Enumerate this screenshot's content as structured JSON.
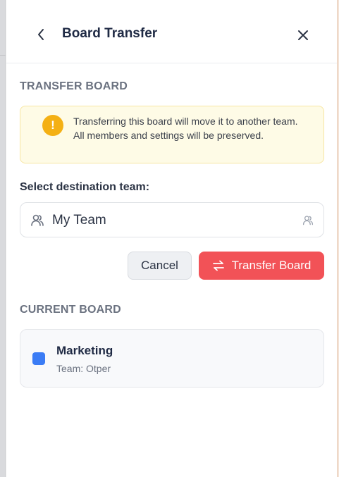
{
  "header": {
    "title": "Board Transfer",
    "back_icon": "chevron-left-icon",
    "close_icon": "close-icon"
  },
  "transfer_section": {
    "title": "TRANSFER BOARD",
    "warning": {
      "icon": "exclamation-icon",
      "icon_glyph": "!",
      "text": "Transferring this board will move it to another team. All members and settings will be preserved.",
      "color": "#f4b014"
    },
    "field_label": "Select destination team:",
    "select": {
      "value": "My Team",
      "lead_icon": "users-icon",
      "trail_icon": "users-icon"
    },
    "buttons": {
      "cancel_label": "Cancel",
      "transfer_label": "Transfer Board",
      "transfer_icon": "swap-arrows-icon",
      "transfer_color": "#f25257"
    }
  },
  "current_section": {
    "title": "CURRENT BOARD",
    "board": {
      "name": "Marketing",
      "team": "Team: Otper",
      "color": "#3b7cf5"
    }
  }
}
